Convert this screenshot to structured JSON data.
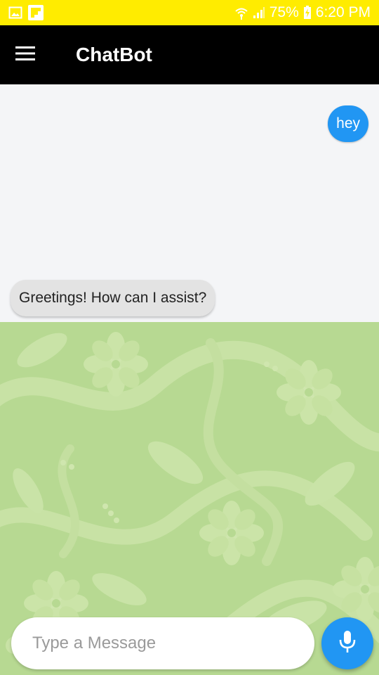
{
  "status_bar": {
    "battery": "75%",
    "time": "6:20 PM",
    "icons": [
      "gallery-icon",
      "flipboard-icon",
      "wifi-icon",
      "signal-icon",
      "charging-icon"
    ]
  },
  "app_bar": {
    "title": "ChatBot",
    "menu_icon": "menu-icon"
  },
  "messages": [
    {
      "sender": "user",
      "text": "hey"
    },
    {
      "sender": "bot",
      "text": "Greetings! How can I assist?"
    }
  ],
  "composer": {
    "placeholder": "Type a Message",
    "value": "",
    "mic_icon": "microphone-icon"
  },
  "colors": {
    "status_bar": "#ffec00",
    "app_bar": "#000000",
    "accent": "#2196f3",
    "bot_bubble": "#e3e3e3",
    "chat_background": "#f4f5f7",
    "wallpaper": "#b7d992"
  }
}
